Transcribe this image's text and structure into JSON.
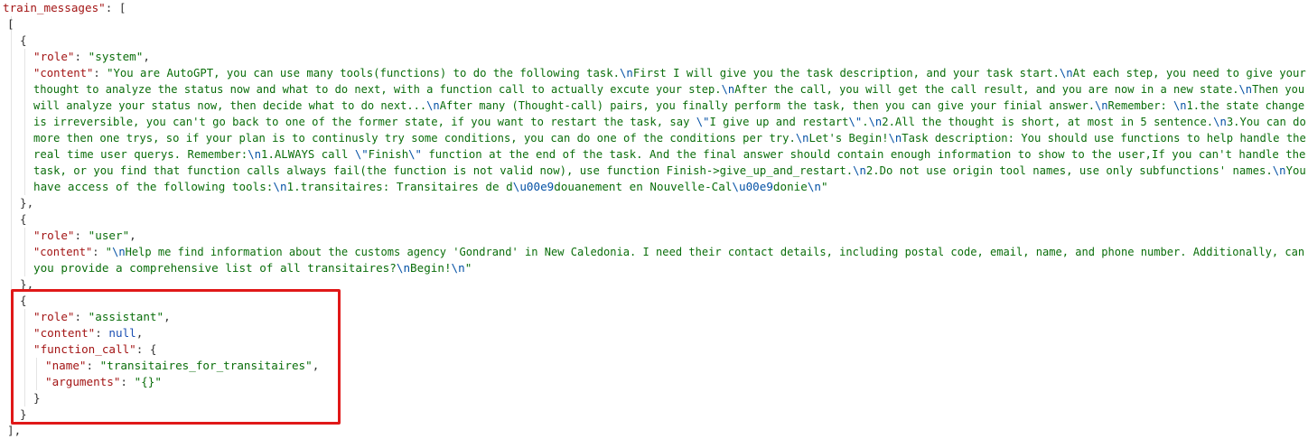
{
  "top_key": "train_messages\"",
  "lines": {
    "open_bracket": "[",
    "brace_open": "{",
    "brace_close_comma": "},",
    "brace_close": "}",
    "bracket_close_comma": "],",
    "colon": ": ",
    "comma": ",",
    "colon_brace": ": {"
  },
  "msg1": {
    "role_key": "\"role\"",
    "role_value": "\"system\"",
    "content_key": "\"content\"",
    "content_lines": [
      "\"You are AutoGPT, you can use many tools(functions) to do the following task.\\nFirst I will give you the task description, and your task start.\\nAt each step, you need to give your",
      "thought to analyze the status now and what to do next, with a function call to actually excute your step.\\nAfter the call, you will get the call result, and you are now in a new state.\\nThen you",
      "will analyze your status now, then decide what to do next...\\nAfter many (Thought-call) pairs, you finally perform the task, then you can give your finial answer.\\nRemember: \\n1.the state change",
      "is irreversible, you can't go back to one of the former state, if you want to restart the task, say \\\"I give up and restart\\\".\\n2.All the thought is short, at most in 5 sentence.\\n3.You can do",
      "more then one trys, so if your plan is to continusly try some conditions, you can do one of the conditions per try.\\nLet's Begin!\\nTask description: You should use functions to help handle the",
      "real time user querys. Remember:\\n1.ALWAYS call \\\"Finish\\\" function at the end of the task. And the final answer should contain enough information to show to the user,If you can't handle the",
      "task, or you find that function calls always fail(the function is not valid now), use function Finish->give_up_and_restart.\\n2.Do not use origin tool names, use only subfunctions' names.\\nYou",
      "have access of the following tools:\\n1.transitaires: Transitaires de d\\u00e9douanement en Nouvelle-Cal\\u00e9donie\\n\""
    ]
  },
  "msg2": {
    "role_key": "\"role\"",
    "role_value": "\"user\"",
    "content_key": "\"content\"",
    "content_lines": [
      "\"\\nHelp me find information about the customs agency 'Gondrand' in New Caledonia. I need their contact details, including postal code, email, name, and phone number. Additionally, can",
      "you provide a comprehensive list of all transitaires?\\nBegin!\\n\""
    ]
  },
  "msg3": {
    "role_key": "\"role\"",
    "role_value": "\"assistant\"",
    "content_key": "\"content\"",
    "content_value": "null",
    "function_call_key": "\"function_call\"",
    "name_key": "\"name\"",
    "name_value": "\"transitaires_for_transitaires\"",
    "arguments_key": "\"arguments\"",
    "arguments_value": "\"{}\""
  },
  "colors": {
    "key": "#a31515",
    "string": "#0b6e0b",
    "escape": "#0451a5",
    "keyword": "#1a4fb3",
    "highlight": "#e01818"
  }
}
